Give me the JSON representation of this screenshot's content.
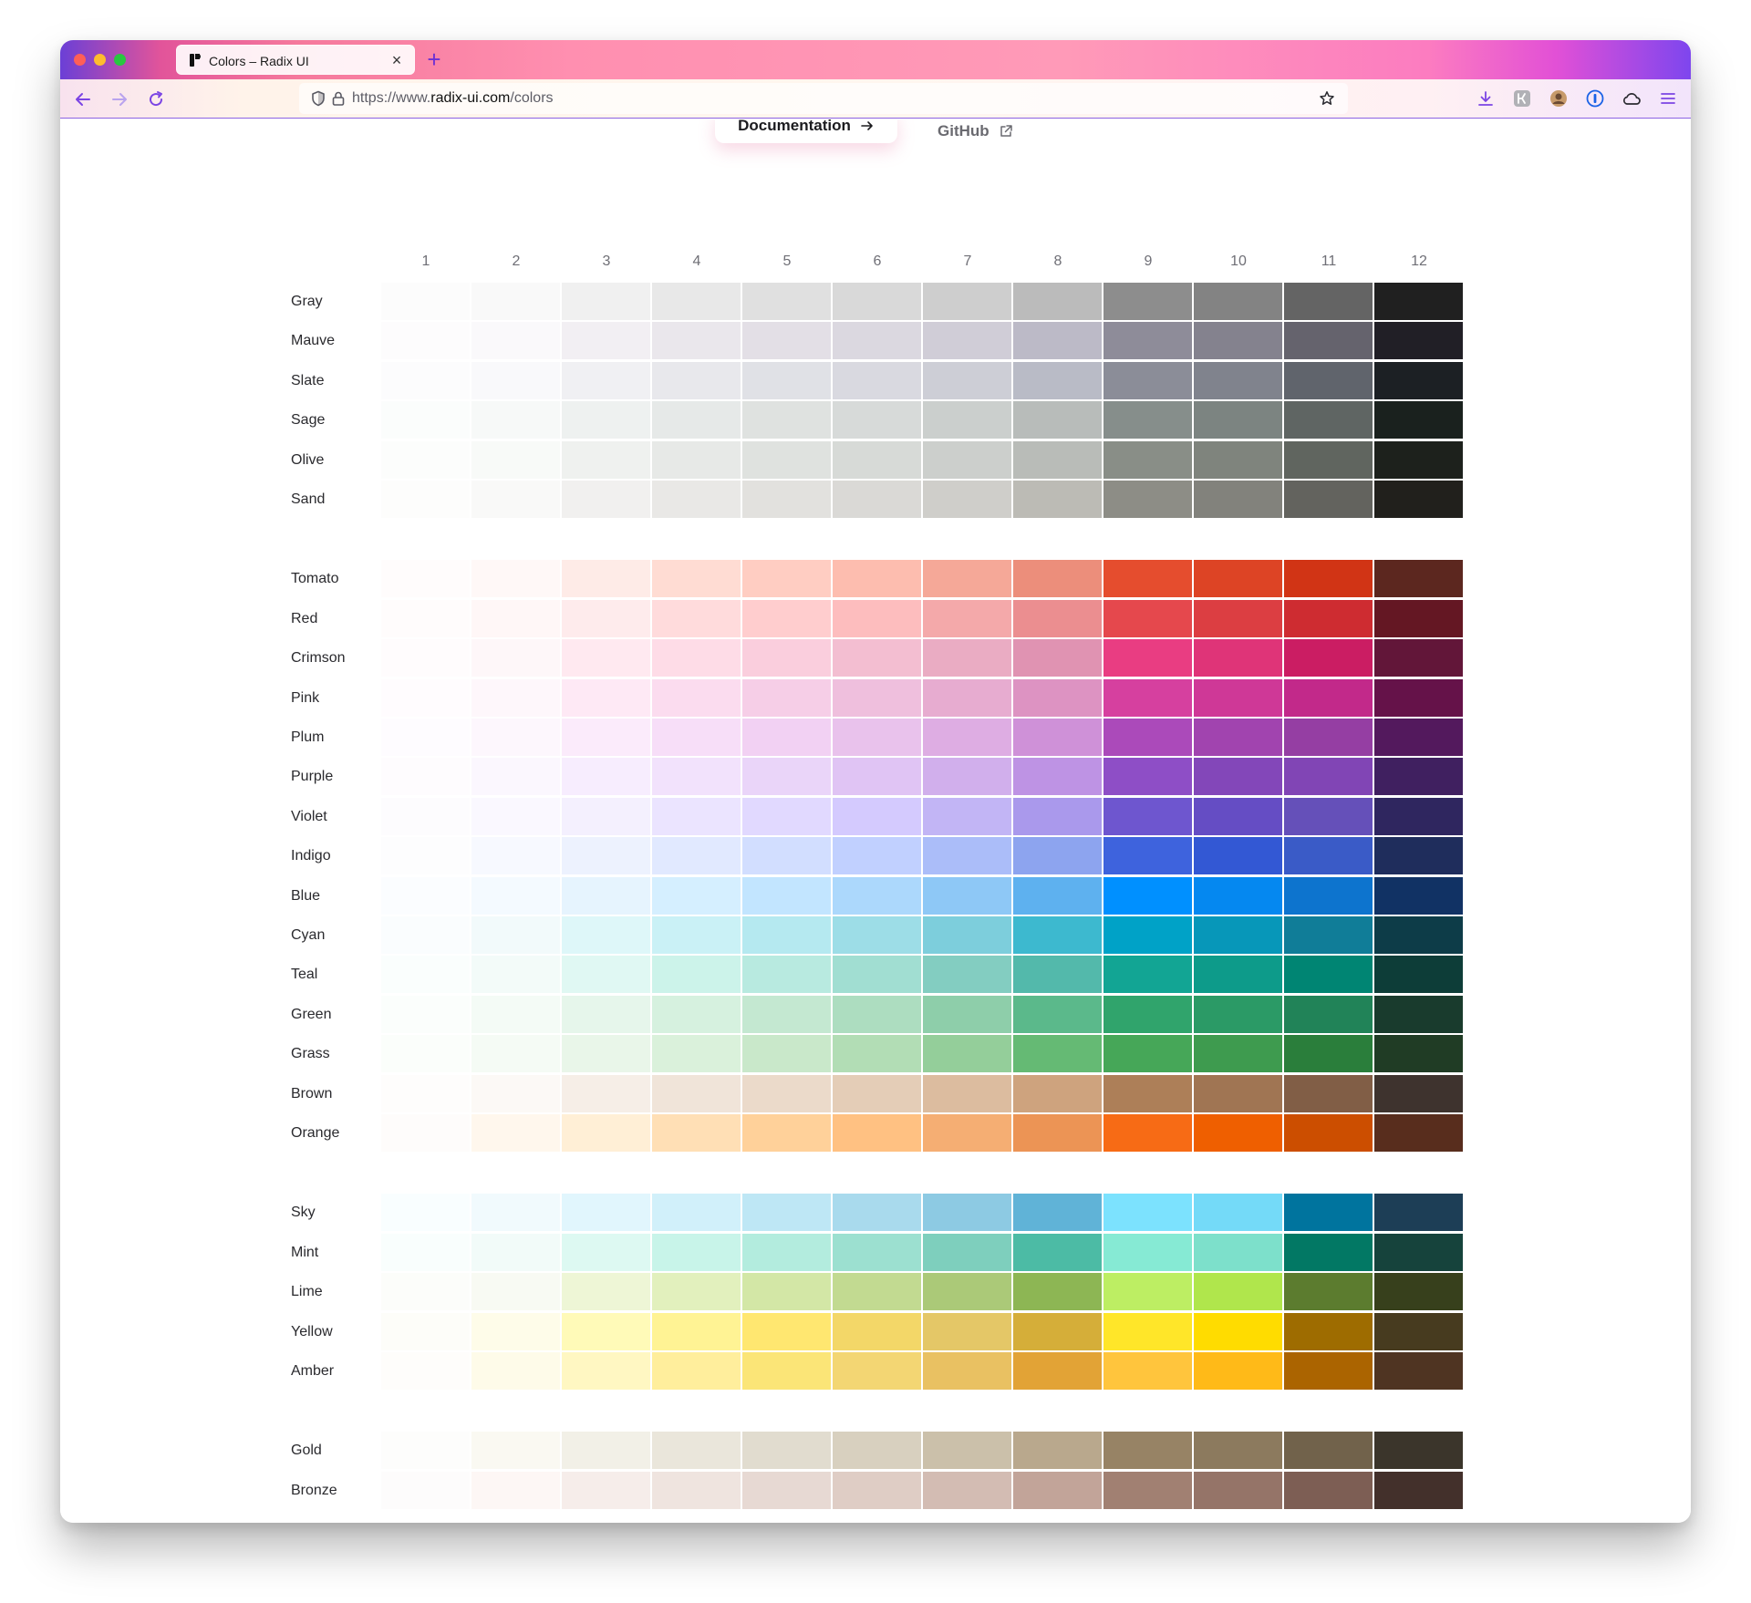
{
  "browser": {
    "tab_title": "Colors – Radix UI",
    "new_tab_label": "+",
    "close_tab_label": "×",
    "url_prefix": "https://www.",
    "url_host": "radix-ui.com",
    "url_path": "/colors",
    "accent_color": "#7b44e4"
  },
  "header": {
    "documentation_label": "Documentation",
    "github_label": "GitHub"
  },
  "color_table": {
    "columns": [
      "1",
      "2",
      "3",
      "4",
      "5",
      "6",
      "7",
      "8",
      "9",
      "10",
      "11",
      "12"
    ],
    "groups": [
      {
        "rows": [
          {
            "name": "Gray",
            "colors": [
              "#fcfcfc",
              "#f9f9f9",
              "#f0f0f0",
              "#e8e8e8",
              "#e0e0e0",
              "#d9d9d9",
              "#cecece",
              "#bbbbbb",
              "#8d8d8d",
              "#838383",
              "#646464",
              "#202020"
            ]
          },
          {
            "name": "Mauve",
            "colors": [
              "#fdfcfd",
              "#faf9fb",
              "#f2eff3",
              "#eae7ec",
              "#e3dfe6",
              "#dbd8e0",
              "#d0cdd7",
              "#bcbac7",
              "#8e8c99",
              "#84828e",
              "#65636d",
              "#211f26"
            ]
          },
          {
            "name": "Slate",
            "colors": [
              "#fcfcfd",
              "#f9f9fb",
              "#f0f0f3",
              "#e8e8ec",
              "#e0e1e6",
              "#d9d9e0",
              "#cdced6",
              "#b9bbc6",
              "#8b8d98",
              "#80838d",
              "#60646c",
              "#1c2024"
            ]
          },
          {
            "name": "Sage",
            "colors": [
              "#fbfdfc",
              "#f7f9f8",
              "#eef1f0",
              "#e6e9e8",
              "#dfe2e0",
              "#d7dad9",
              "#cbcfcd",
              "#b8bcba",
              "#868e8b",
              "#7c8481",
              "#5f6563",
              "#1a211e"
            ]
          },
          {
            "name": "Olive",
            "colors": [
              "#fcfdfc",
              "#f8faf8",
              "#eff1ef",
              "#e7e9e7",
              "#dfe2df",
              "#d7dad7",
              "#cccfcc",
              "#b9bcb8",
              "#898e87",
              "#7f847d",
              "#60655f",
              "#1d211c"
            ]
          },
          {
            "name": "Sand",
            "colors": [
              "#fdfdfc",
              "#f9f9f8",
              "#f1f0ef",
              "#e9e8e6",
              "#e2e1de",
              "#dad9d6",
              "#cfceca",
              "#bcbbb5",
              "#8d8d86",
              "#82827c",
              "#63635e",
              "#21201c"
            ]
          }
        ]
      },
      {
        "rows": [
          {
            "name": "Tomato",
            "colors": [
              "#fffcfc",
              "#fff8f7",
              "#feebe7",
              "#ffdcd3",
              "#ffcdc2",
              "#fdbdaf",
              "#f5a898",
              "#ec8e7b",
              "#e54d2e",
              "#dd4425",
              "#d13415",
              "#5c271f"
            ]
          },
          {
            "name": "Red",
            "colors": [
              "#fffcfc",
              "#fff7f7",
              "#feebec",
              "#ffdbdc",
              "#ffcdce",
              "#fdbdbe",
              "#f4a9aa",
              "#eb8e90",
              "#e5484d",
              "#dc3e42",
              "#ce2c31",
              "#641723"
            ]
          },
          {
            "name": "Crimson",
            "colors": [
              "#fffcfd",
              "#fef7f9",
              "#ffe9f0",
              "#fedce7",
              "#facedd",
              "#f3bed1",
              "#eaacc3",
              "#e093b2",
              "#e93d82",
              "#df3478",
              "#cb1d63",
              "#621639"
            ]
          },
          {
            "name": "Pink",
            "colors": [
              "#fffcfe",
              "#fef7fb",
              "#fee9f5",
              "#fbdcef",
              "#f6cee7",
              "#efbfdd",
              "#e7acd0",
              "#dd93c2",
              "#d6409f",
              "#cf3897",
              "#c2298a",
              "#651249"
            ]
          },
          {
            "name": "Plum",
            "colors": [
              "#fefcff",
              "#fdf7fd",
              "#fbebfb",
              "#f7def8",
              "#f2d1f3",
              "#e9c2ec",
              "#deade3",
              "#cf91d8",
              "#ab4aba",
              "#a144af",
              "#953ea3",
              "#53195d"
            ]
          },
          {
            "name": "Purple",
            "colors": [
              "#fefcfe",
              "#fbf7fe",
              "#f7edfe",
              "#f2e2fc",
              "#ead5f9",
              "#e0c4f4",
              "#d1afec",
              "#be93e4",
              "#8e4ec6",
              "#8347b9",
              "#8145b5",
              "#402060"
            ]
          },
          {
            "name": "Violet",
            "colors": [
              "#fdfcfe",
              "#faf8ff",
              "#f4f0fe",
              "#ebe4ff",
              "#e1d9ff",
              "#d4cafe",
              "#c2b5f5",
              "#aa99ec",
              "#6e56cf",
              "#654dc4",
              "#6550b9",
              "#2f265f"
            ]
          },
          {
            "name": "Indigo",
            "colors": [
              "#fdfdfe",
              "#f7f9ff",
              "#edf2fe",
              "#e1e9ff",
              "#d2deff",
              "#c1d0ff",
              "#abbdf9",
              "#8da4ef",
              "#3e63dd",
              "#3358d4",
              "#3a5bc7",
              "#1f2d5c"
            ]
          },
          {
            "name": "Blue",
            "colors": [
              "#fbfdff",
              "#f4faff",
              "#e6f4fe",
              "#d5efff",
              "#c2e5ff",
              "#acd8fc",
              "#8ec8f6",
              "#5eb1ef",
              "#0090ff",
              "#0588f0",
              "#0d74ce",
              "#113264"
            ]
          },
          {
            "name": "Cyan",
            "colors": [
              "#fafdfe",
              "#f2fafb",
              "#def7f9",
              "#caf1f6",
              "#b5e9f0",
              "#9ddde7",
              "#7dcedc",
              "#3db9cf",
              "#00a2c7",
              "#0797b9",
              "#107d98",
              "#0d3c48"
            ]
          },
          {
            "name": "Teal",
            "colors": [
              "#fafefd",
              "#f3fbf9",
              "#e0f8f3",
              "#ccf3ea",
              "#b8eae0",
              "#a1ded2",
              "#83cdc1",
              "#53b9ab",
              "#12a594",
              "#0d9b8a",
              "#008573",
              "#0d3d38"
            ]
          },
          {
            "name": "Green",
            "colors": [
              "#fbfefc",
              "#f4fbf6",
              "#e6f6eb",
              "#d6f1df",
              "#c4e8d1",
              "#adddc0",
              "#8eceaa",
              "#5bb98b",
              "#30a46c",
              "#2b9a66",
              "#218358",
              "#193b2d"
            ]
          },
          {
            "name": "Grass",
            "colors": [
              "#fbfefb",
              "#f5fbf5",
              "#e9f6e9",
              "#daf1db",
              "#c9e8ca",
              "#b2ddb5",
              "#94ce9a",
              "#65ba74",
              "#46a758",
              "#3e9b4f",
              "#2a7e3b",
              "#203c25"
            ]
          },
          {
            "name": "Brown",
            "colors": [
              "#fefdfc",
              "#fcf9f6",
              "#f6eee7",
              "#f0e4d9",
              "#ebdaca",
              "#e4cdb7",
              "#dcbc9f",
              "#cea37e",
              "#ad7f58",
              "#a07553",
              "#815e46",
              "#3e332e"
            ]
          },
          {
            "name": "Orange",
            "colors": [
              "#fefcfb",
              "#fff7ed",
              "#ffefd6",
              "#ffdfb5",
              "#ffd19a",
              "#ffc182",
              "#f5ae73",
              "#ec9455",
              "#f76b15",
              "#ef5f00",
              "#cc4e00",
              "#582d1d"
            ]
          }
        ]
      },
      {
        "rows": [
          {
            "name": "Sky",
            "colors": [
              "#f9feff",
              "#f1fafd",
              "#e1f6fd",
              "#d1f0fa",
              "#bee7f5",
              "#a9daed",
              "#8dcae3",
              "#60b3d7",
              "#7ce2fe",
              "#74daf8",
              "#00749e",
              "#1d3e56"
            ]
          },
          {
            "name": "Mint",
            "colors": [
              "#f9fefd",
              "#f2fbf9",
              "#ddf9f2",
              "#c8f4e9",
              "#b3ecde",
              "#9ce0d0",
              "#7ecfbd",
              "#4cbba5",
              "#86ead4",
              "#7de0cb",
              "#027864",
              "#16433c"
            ]
          },
          {
            "name": "Lime",
            "colors": [
              "#fcfdfa",
              "#f8faf3",
              "#eef6d6",
              "#e2f0bd",
              "#d3e7a6",
              "#c2da91",
              "#abc978",
              "#8db654",
              "#bdee63",
              "#b0e64c",
              "#5c7c2f",
              "#37401c"
            ]
          },
          {
            "name": "Yellow",
            "colors": [
              "#fdfdf9",
              "#fefce9",
              "#fffab8",
              "#fff394",
              "#ffe770",
              "#f3d768",
              "#e4c767",
              "#d5ae39",
              "#ffe629",
              "#ffdc00",
              "#9e6c00",
              "#473b1f"
            ]
          },
          {
            "name": "Amber",
            "colors": [
              "#fefdfb",
              "#fefbe9",
              "#fff7c2",
              "#ffee9c",
              "#fbe577",
              "#f3d673",
              "#e9c162",
              "#e2a336",
              "#ffc53d",
              "#ffba18",
              "#ab6400",
              "#4f3422"
            ]
          }
        ]
      },
      {
        "rows": [
          {
            "name": "Gold",
            "colors": [
              "#fdfdfc",
              "#faf9f2",
              "#f2f0e7",
              "#eae6db",
              "#e1dccf",
              "#d8d0bf",
              "#cbc0aa",
              "#b9a88d",
              "#978365",
              "#8c7a5e",
              "#71624b",
              "#3b352b"
            ]
          },
          {
            "name": "Bronze",
            "colors": [
              "#fdfcfc",
              "#fdf7f5",
              "#f6edea",
              "#efe4df",
              "#e7d9d3",
              "#dfcdc5",
              "#d3bcb3",
              "#c2a499",
              "#a18072",
              "#957468",
              "#7d5e54",
              "#43302b"
            ]
          }
        ]
      }
    ]
  }
}
